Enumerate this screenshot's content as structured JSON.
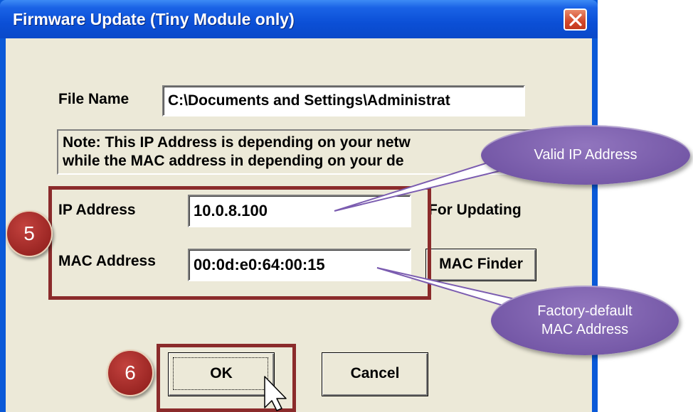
{
  "window": {
    "title": "Firmware Update (Tiny Module only)"
  },
  "form": {
    "file_name_label": "File Name",
    "file_name_value": "C:\\Documents and Settings\\Administrat",
    "note_line1": "Note: This IP Address is depending on your netw",
    "note_line2": "while the  MAC address in depending on your de",
    "ip_label": "IP Address",
    "ip_value": "10.0.8.100",
    "ip_suffix": "For Updating",
    "mac_label": "MAC Address",
    "mac_value": "00:0d:e0:64:00:15",
    "mac_finder_label": "MAC Finder",
    "ok_label": "OK",
    "cancel_label": "Cancel"
  },
  "annotations": {
    "step5": "5",
    "step6": "6",
    "callout_ip": "Valid IP Address",
    "callout_mac_line1": "Factory-default",
    "callout_mac_line2": "MAC Address"
  },
  "icons": {
    "close": "close-icon",
    "cursor": "mouse-pointer-icon"
  },
  "colors": {
    "titlebar": "#0b4fd6",
    "dialog_bg": "#ece9d8",
    "highlight_border": "#8b2b2b",
    "step_badge": "#a52a2a",
    "callout": "#7b5cb0"
  }
}
